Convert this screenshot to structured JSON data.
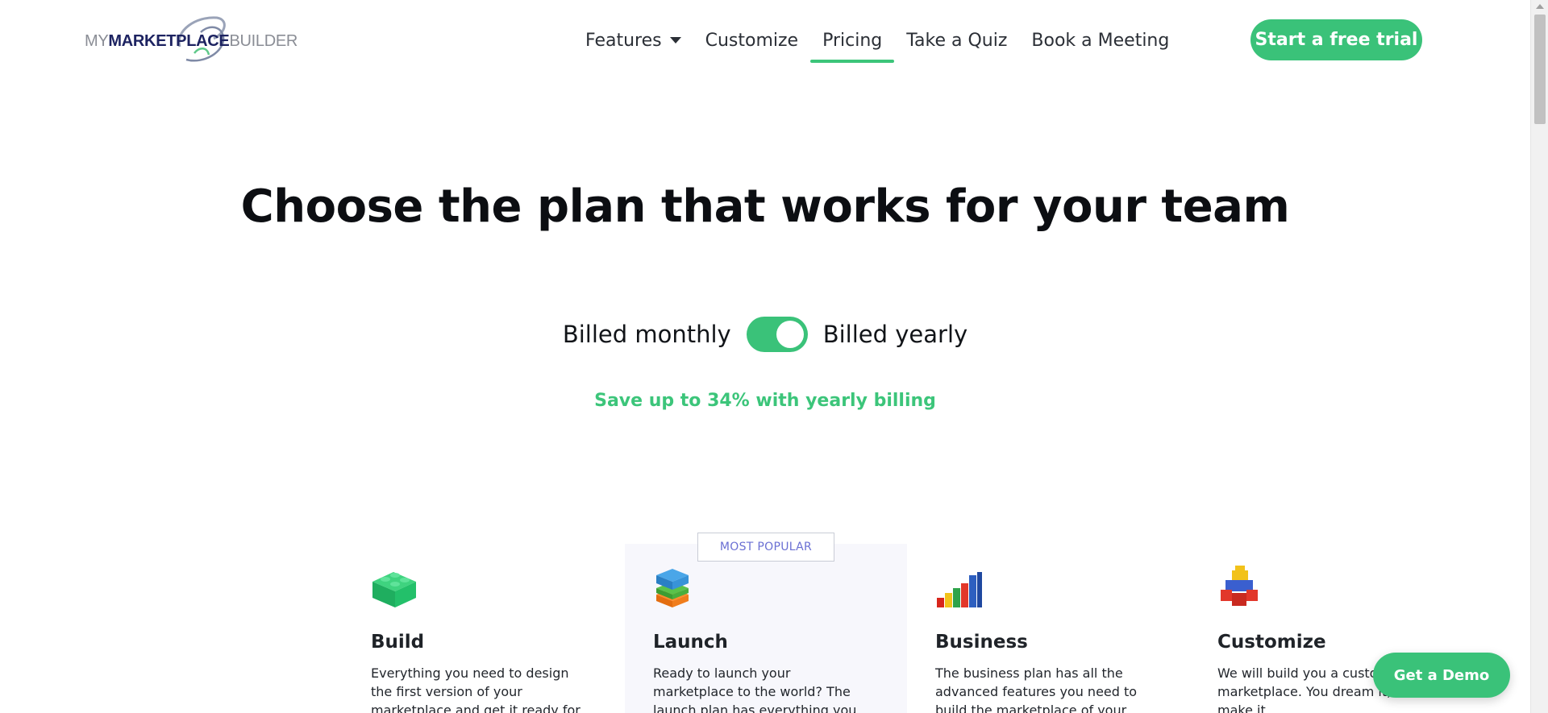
{
  "header": {
    "logo": {
      "prefix": "MY",
      "brand": "MARKETPLACE",
      "suffix": "BUILDER"
    },
    "nav": [
      {
        "label": "Features",
        "has_dropdown": true
      },
      {
        "label": "Customize"
      },
      {
        "label": "Pricing",
        "active": true
      },
      {
        "label": "Take a Quiz"
      },
      {
        "label": "Book a Meeting"
      }
    ],
    "cta_label": "Start a free trial"
  },
  "hero": {
    "title": "Choose the plan that works for your team",
    "billing": {
      "monthly_label": "Billed monthly",
      "yearly_label": "Billed yearly",
      "yearly_selected": true
    },
    "save_text": "Save up to 34% with yearly billing"
  },
  "plans": [
    {
      "name": "Build",
      "icon": "green-lego-brick-icon",
      "description": "Everything you need to design the first version of your marketplace and get it ready for launch."
    },
    {
      "name": "Launch",
      "icon": "stacked-lego-bricks-icon",
      "badge": "MOST POPULAR",
      "description": "Ready to launch your marketplace to the world? The launch plan has everything you need to grow."
    },
    {
      "name": "Business",
      "icon": "lego-bar-chart-icon",
      "description": "The business plan has all the advanced features you need to build the marketplace of your dreams."
    },
    {
      "name": "Customize",
      "icon": "lego-figure-icon",
      "description": "We will build you a custom marketplace. You dream it, we make it."
    }
  ],
  "floating": {
    "demo_label": "Get a Demo"
  },
  "colors": {
    "accent": "#3ac279",
    "badge_text": "#6a6fd3",
    "logo_brand": "#1d2361",
    "popular_bg": "#f7f7fc"
  }
}
